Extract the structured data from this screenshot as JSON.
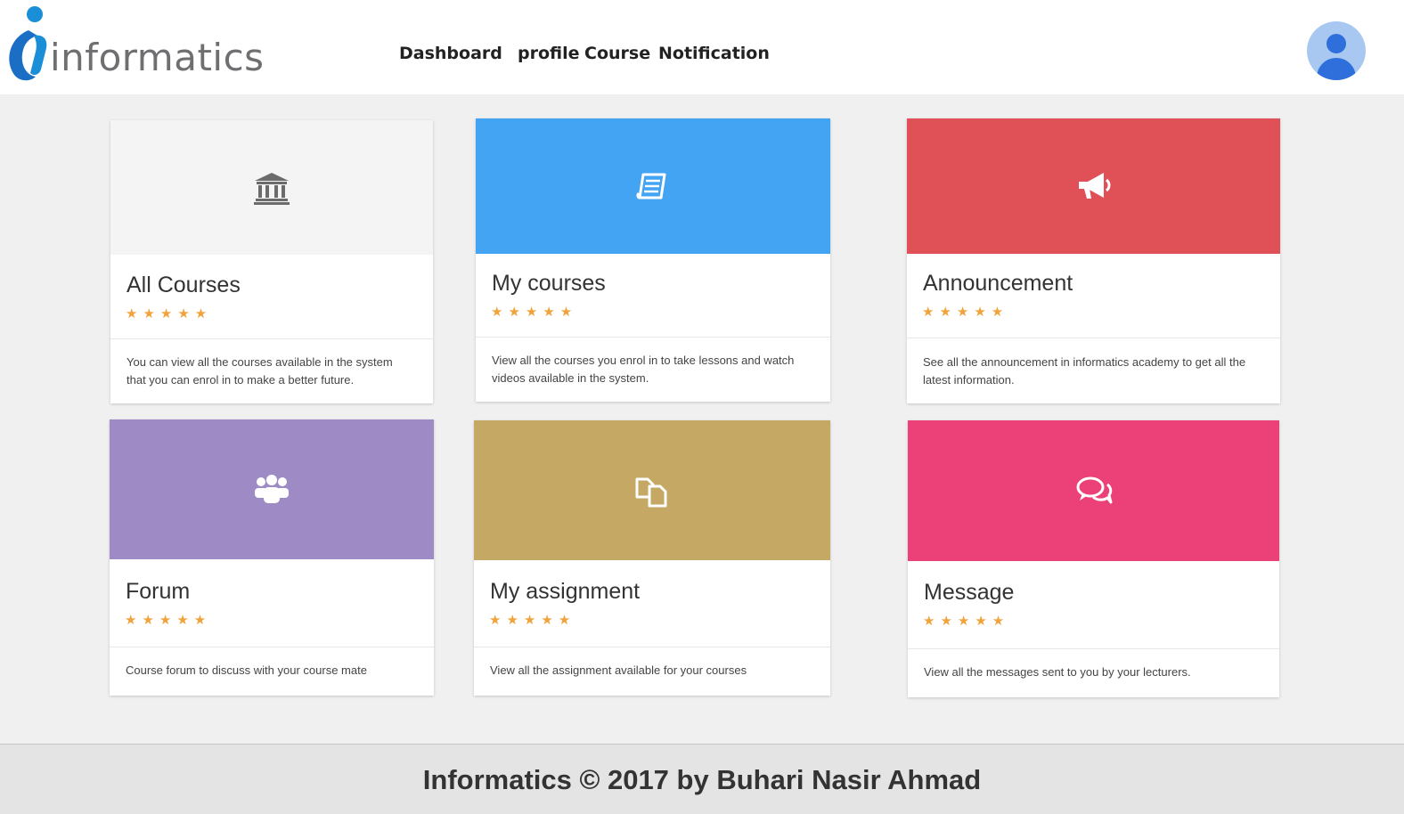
{
  "app": {
    "logo_text": "informatics"
  },
  "nav": {
    "items": [
      "Dashboard",
      "profile",
      "Course",
      "Notification"
    ]
  },
  "colors": {
    "all_courses": "#f4f4f4",
    "my_courses": "#44a4f4",
    "announcement": "#e05157",
    "forum": "#9e8bc6",
    "assignment": "#c4a864",
    "message": "#ec4079",
    "stars": "#f0a33b",
    "logo_blue": "#1a8fd8"
  },
  "cards": [
    {
      "title": "All Courses",
      "rating": "★★★★★",
      "icon": "bank-icon",
      "description": "You can view all the courses available in the system that you can enrol in to make a better future."
    },
    {
      "title": "My courses",
      "rating": "★★★★★",
      "icon": "book-icon",
      "description": "View all the courses you enrol in to take lessons and watch videos available in the system."
    },
    {
      "title": "Announcement",
      "rating": "★★★★★",
      "icon": "megaphone-icon",
      "description": "See all the announcement in informatics academy to get all the latest information."
    },
    {
      "title": "Forum",
      "rating": "★★★★★",
      "icon": "users-icon",
      "description": "Course forum to discuss with your course mate"
    },
    {
      "title": "My assignment",
      "rating": "★★★★★",
      "icon": "files-icon",
      "description": "View all the assignment available for your courses"
    },
    {
      "title": "Message",
      "rating": "★★★★★",
      "icon": "comments-icon",
      "description": "View all the messages sent to you by your lecturers."
    }
  ],
  "footer": {
    "text": "Informatics © 2017 by Buhari Nasir Ahmad"
  }
}
